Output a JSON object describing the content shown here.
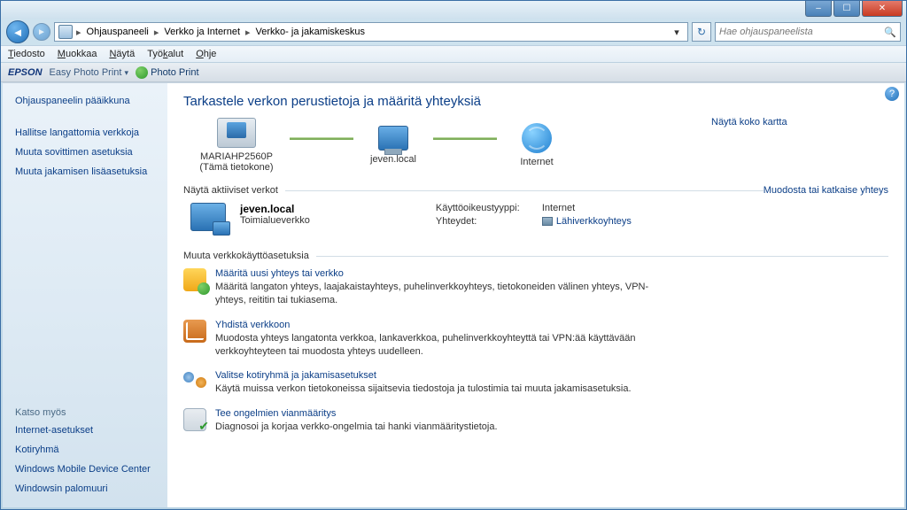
{
  "window": {
    "min_glyph": "–",
    "max_glyph": "☐",
    "close_glyph": "✕"
  },
  "nav": {
    "back_glyph": "◄",
    "fwd_glyph": "►",
    "refresh_glyph": "↻",
    "dropdown_glyph": "▾"
  },
  "breadcrumbs": {
    "sep": "▸",
    "root": "Ohjauspaneeli",
    "level1": "Verkko ja Internet",
    "level2": "Verkko- ja jakamiskeskus"
  },
  "search": {
    "placeholder": "Hae ohjauspaneelista",
    "mag": "🔍"
  },
  "menubar": {
    "file": "Tiedosto",
    "edit": "Muokkaa",
    "view": "Näytä",
    "tools": "Työkalut",
    "help": "Ohje"
  },
  "epson": {
    "brand": "EPSON",
    "easy": "Easy Photo Print",
    "dd": "▾",
    "pp": "Photo Print"
  },
  "sidebar": {
    "items": [
      "Ohjauspaneelin pääikkuna",
      "Hallitse langattomia verkkoja",
      "Muuta sovittimen asetuksia",
      "Muuta jakamisen lisäasetuksia"
    ],
    "see_also_hdr": "Katso myös",
    "see_also": [
      "Internet-asetukset",
      "Kotiryhmä",
      "Windows Mobile Device Center",
      "Windowsin palomuuri"
    ]
  },
  "main": {
    "title": "Tarkastele verkon perustietoja ja määritä yhteyksiä",
    "show_map": "Näytä koko kartta",
    "topo": {
      "pc_name": "MARIAHP2560P",
      "pc_sub": "(Tämä tietokone)",
      "domain": "jeven.local",
      "internet": "Internet"
    },
    "active_hdr": "Näytä aktiiviset verkot",
    "active_action": "Muodosta tai katkaise yhteys",
    "active_net": {
      "name": "jeven.local",
      "type": "Toimialueverkko"
    },
    "kv": {
      "access_k": "Käyttöoikeustyyppi:",
      "access_v": "Internet",
      "conn_k": "Yhteydet:",
      "conn_v": "Lähiverkkoyhteys"
    },
    "settings_hdr": "Muuta verkkokäyttöasetuksia",
    "tasks": [
      {
        "title": "Määritä uusi yhteys tai verkko",
        "desc": "Määritä langaton yhteys, laajakaistayhteys, puhelinverkkoyhteys, tietokoneiden välinen yhteys, VPN-yhteys, reititin tai tukiasema."
      },
      {
        "title": "Yhdistä verkkoon",
        "desc": "Muodosta yhteys langatonta verkkoa, lankaverkkoa, puhelinverkkoyhteyttä tai VPN:ää käyttävään verkkoyhteyteen tai muodosta yhteys uudelleen."
      },
      {
        "title": "Valitse kotiryhmä ja jakamisasetukset",
        "desc": "Käytä muissa verkon tietokoneissa sijaitsevia tiedostoja ja tulostimia tai muuta jakamisasetuksia."
      },
      {
        "title": "Tee ongelmien vianmääritys",
        "desc": "Diagnosoi ja korjaa verkko-ongelmia tai hanki vianmääritystietoja."
      }
    ],
    "help_glyph": "?"
  }
}
